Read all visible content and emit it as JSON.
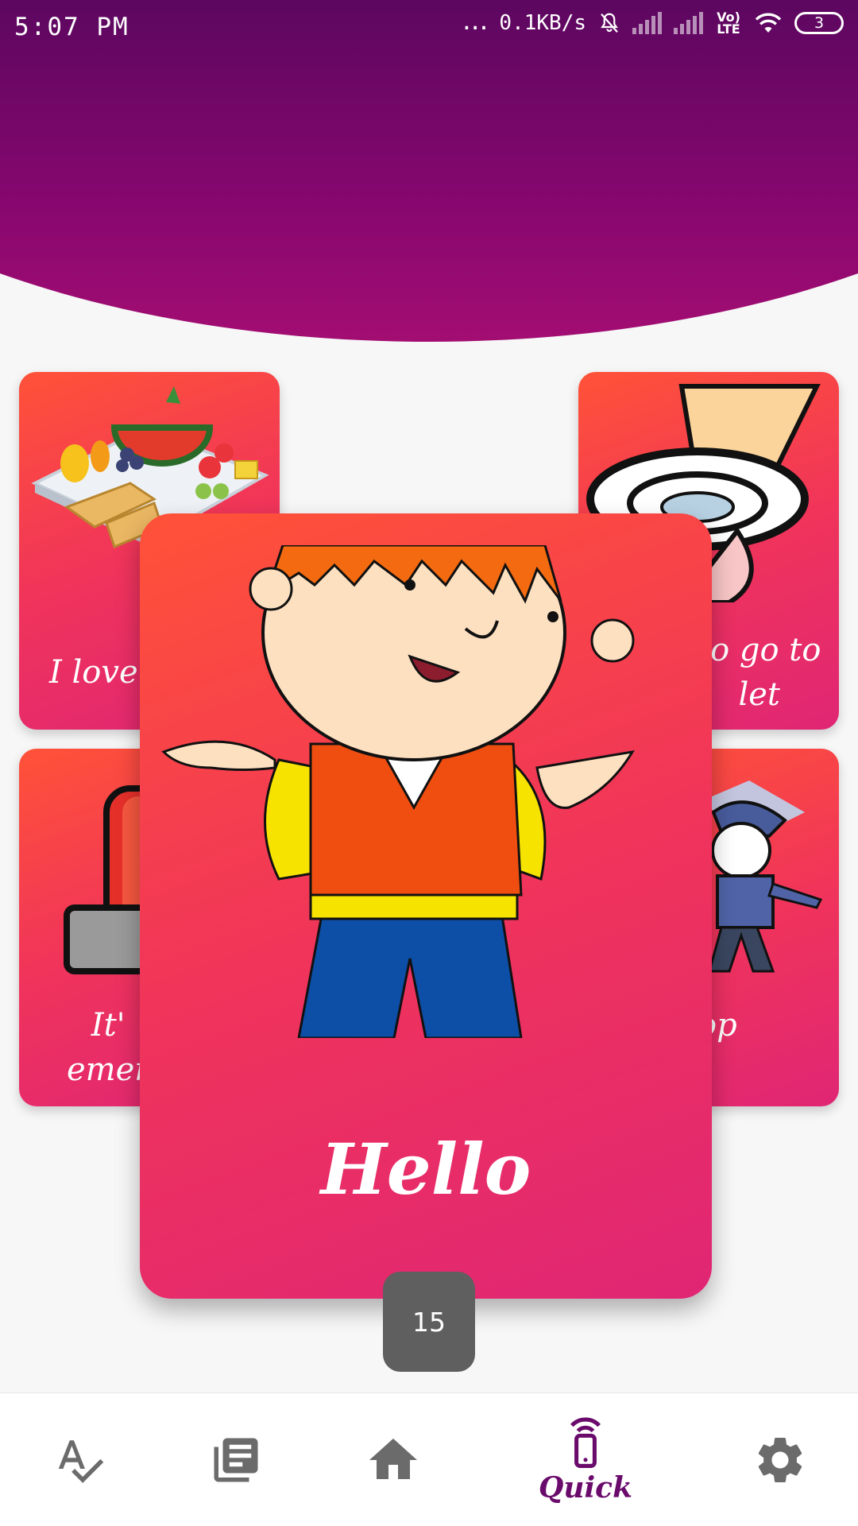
{
  "status_bar": {
    "time": "5:07 PM",
    "more": "...",
    "speed": "0.1KB/s",
    "volte": "Vo) LTE",
    "battery": "3"
  },
  "cards": {
    "top_left_label": "I love",
    "top_right_label": "to go to\nlet",
    "bottom_left_label": "It'\nemer",
    "bottom_right_label": "op",
    "main_label": "Hello"
  },
  "counter": "15",
  "nav": {
    "quick_label": "Quick",
    "icons": [
      "spellcheck-icon",
      "library-books-icon",
      "home-icon",
      "quick-remote-icon",
      "settings-icon"
    ]
  },
  "colors": {
    "header_top": "#5c0760",
    "header_bottom": "#a30d72",
    "card_start": "#ff5238",
    "card_end": "#e02674",
    "nav_icon": "#6b6b6b",
    "nav_active": "#6a0b6c"
  }
}
